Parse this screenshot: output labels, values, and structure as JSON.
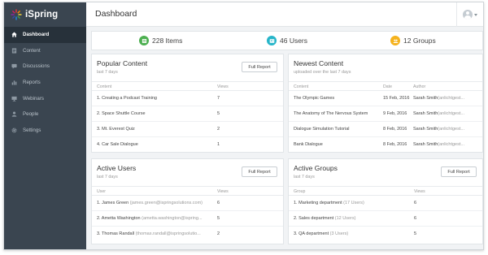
{
  "app": {
    "name": "iSpring"
  },
  "sidebar": {
    "items": [
      {
        "label": "Dashboard",
        "icon": "home-icon",
        "active": true
      },
      {
        "label": "Content",
        "icon": "document-icon"
      },
      {
        "label": "Discussions",
        "icon": "chat-icon"
      },
      {
        "label": "Reports",
        "icon": "bar-chart-icon"
      },
      {
        "label": "Webinars",
        "icon": "monitor-icon"
      },
      {
        "label": "People",
        "icon": "person-icon"
      },
      {
        "label": "Settings",
        "icon": "gear-icon"
      }
    ]
  },
  "header": {
    "title": "Dashboard"
  },
  "stats": {
    "items": {
      "label": "228 Items",
      "color": "#4caf50",
      "icon": "items-icon"
    },
    "users": {
      "label": "46 Users",
      "color": "#26b5c9",
      "icon": "users-icon"
    },
    "groups": {
      "label": "12 Groups",
      "color": "#f5b21d",
      "icon": "groups-icon"
    }
  },
  "popular_content": {
    "title": "Popular Content",
    "subtitle": "last 7 days",
    "button": "Full Report",
    "columns": [
      "Content",
      "Views"
    ],
    "rows": [
      {
        "content": "1. Creating a Podcast Training",
        "views": "7"
      },
      {
        "content": "2. Space Shuttle Course",
        "views": "5"
      },
      {
        "content": "3. Mt. Everest Quiz",
        "views": "2"
      },
      {
        "content": "4. Car Sale Dialogue",
        "views": "1"
      }
    ]
  },
  "newest_content": {
    "title": "Newest Content",
    "subtitle": "uploaded over the last 7 days",
    "columns": [
      "Content",
      "Date",
      "Author"
    ],
    "rows": [
      {
        "content": "The Olympic Games",
        "date": "15 Feb, 2016",
        "author": "Sarah Smith",
        "author_email": "(anlichtgest..."
      },
      {
        "content": "The Anatomy of The Nervous System",
        "date": "9 Feb, 2016",
        "author": "Sarah Smith",
        "author_email": "(anlichtgest..."
      },
      {
        "content": "Dialogue Simulation Tutorial",
        "date": "8 Feb, 2016",
        "author": "Sarah Smith",
        "author_email": "(anlichtgest..."
      },
      {
        "content": "Bank Dialogue",
        "date": "8 Feb, 2016",
        "author": "Sarah Smith",
        "author_email": "(anlichtgest..."
      }
    ]
  },
  "active_users": {
    "title": "Active Users",
    "subtitle": "last 7 days",
    "button": "Full Report",
    "columns": [
      "User",
      "Views"
    ],
    "rows": [
      {
        "name": "1. James Green",
        "email": "(james.green@ispringsolutions.com)",
        "views": "6"
      },
      {
        "name": "2. Ametta Washington",
        "email": "(ametta.washington@ispring...",
        "views": "5"
      },
      {
        "name": "3. Thomas Randall",
        "email": "(thomas.randall@ispringsolutio...",
        "views": "2"
      }
    ]
  },
  "active_groups": {
    "title": "Active Groups",
    "subtitle": "last 7 days",
    "button": "Full Report",
    "columns": [
      "Group",
      "Views"
    ],
    "rows": [
      {
        "name": "1. Marketing department",
        "count": "(17 Users)",
        "views": "6"
      },
      {
        "name": "2. Sales department",
        "count": "(12 Users)",
        "views": "6"
      },
      {
        "name": "3. QA department",
        "count": "(3 Users)",
        "views": "5"
      }
    ]
  }
}
